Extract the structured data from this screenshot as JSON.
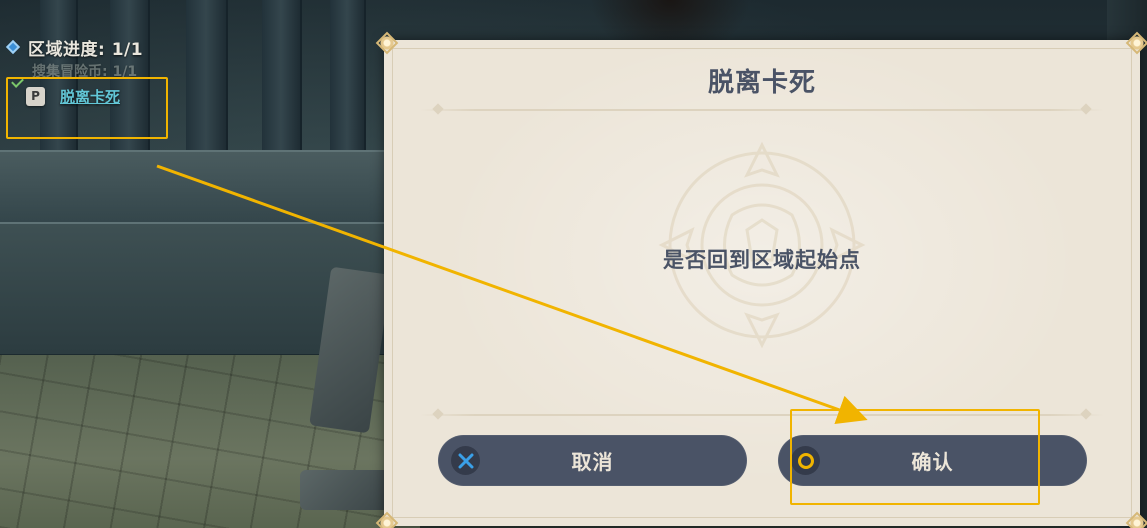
{
  "hud": {
    "region_progress": "区域进度: 1/1",
    "sub_objective": "搜集冒险币: 1/1",
    "hotkey": "P",
    "unstuck_label": "脱离卡死"
  },
  "dialog": {
    "title": "脱离卡死",
    "message": "是否回到区域起始点",
    "cancel_label": "取消",
    "confirm_label": "确认"
  },
  "colors": {
    "highlight": "#f1b400",
    "dialog_bg": "#ece5d8",
    "button_bg": "#4a5366",
    "text_dark": "#4a5366",
    "cancel_icon": "#3aa0e8",
    "confirm_icon": "#f0b400",
    "link": "#62c6d6"
  },
  "icons": {
    "progress": "diamond-icon",
    "completed": "check-icon",
    "cancel": "cross-icon",
    "confirm": "circle-icon"
  }
}
